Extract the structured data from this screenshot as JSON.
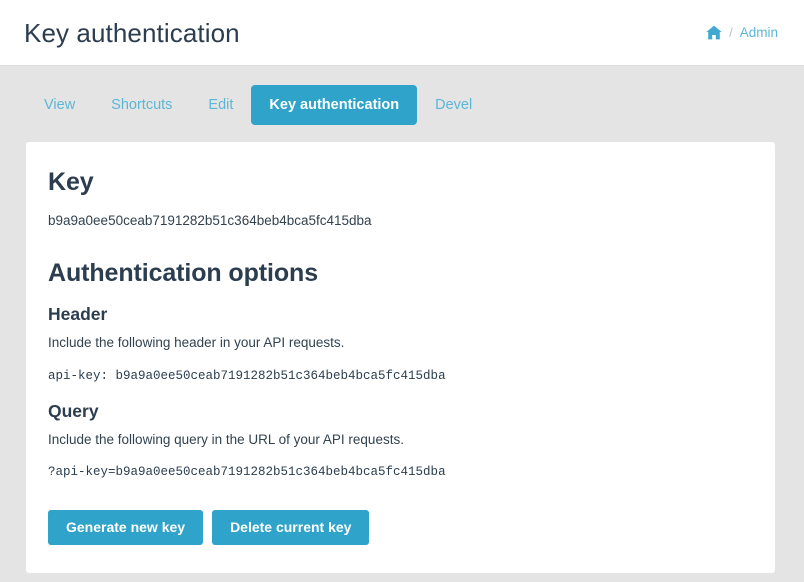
{
  "header": {
    "title": "Key authentication",
    "breadcrumb": {
      "home_icon": "home-icon",
      "separator": "/",
      "link_label": "Admin"
    }
  },
  "tabs": [
    {
      "label": "View",
      "active": false
    },
    {
      "label": "Shortcuts",
      "active": false
    },
    {
      "label": "Edit",
      "active": false
    },
    {
      "label": "Key authentication",
      "active": true
    },
    {
      "label": "Devel",
      "active": false
    }
  ],
  "card": {
    "key_section": {
      "heading": "Key",
      "value": "b9a9a0ee50ceab7191282b51c364beb4bca5fc415dba"
    },
    "options_section": {
      "heading": "Authentication options",
      "header_option": {
        "heading": "Header",
        "description": "Include the following header in your API requests.",
        "code": "api-key: b9a9a0ee50ceab7191282b51c364beb4bca5fc415dba"
      },
      "query_option": {
        "heading": "Query",
        "description": "Include the following query in the URL of your API requests.",
        "code": "?api-key=b9a9a0ee50ceab7191282b51c364beb4bca5fc415dba"
      }
    },
    "actions": {
      "generate_label": "Generate new key",
      "delete_label": "Delete current key"
    }
  },
  "colors": {
    "accent": "#2fa3ca",
    "link": "#5bb7d6",
    "page_background": "#e4e4e4",
    "card_background": "#ffffff",
    "text": "#2b3d4f"
  }
}
